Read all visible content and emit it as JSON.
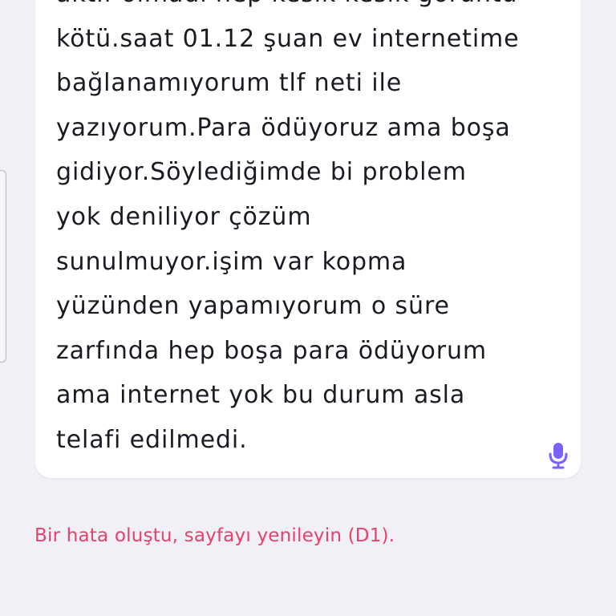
{
  "complaint": {
    "lines": [
      "aktif olmadı hep kesik kesik görüntü",
      "kötü.saat 01.12 şuan ev internetime",
      "bağlanamıyorum tlf neti ile",
      "yazıyorum.Para ödüyoruz ama boşa",
      "gidiyor.Söylediğimde bi problem",
      "yok deniliyor çözüm",
      "sunulmuyor.işim var kopma",
      "yüzünden yapamıyorum o süre",
      "zarfında hep boşa para ödüyorum",
      "ama internet yok bu durum asla",
      "telafi edilmedi."
    ],
    "mic_icon": "microphone-icon"
  },
  "error": {
    "message": "Bir hata oluştu, sayfayı yenileyin (D1)."
  },
  "colors": {
    "page_background": "#f1f0f6",
    "card_background": "#ffffff",
    "text": "#1b1a22",
    "error_text": "#e8406a",
    "accent": "#7b61ff"
  }
}
